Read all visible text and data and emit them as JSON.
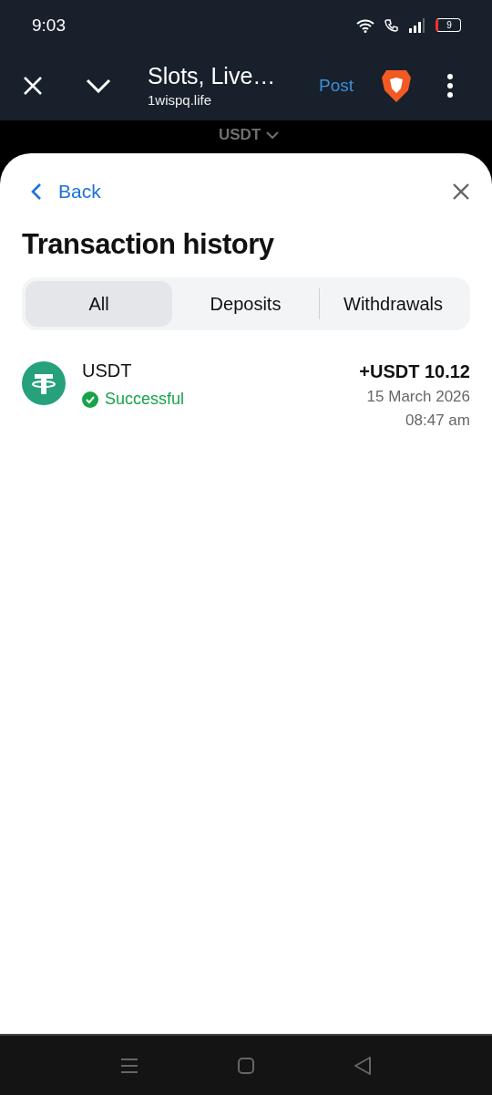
{
  "status_bar": {
    "time": "9:03",
    "battery": "9"
  },
  "browser_bar": {
    "title": "Slots, Live…",
    "url": "1wispq.life",
    "action": "Post"
  },
  "page_behind": {
    "currency": "USDT"
  },
  "sheet": {
    "back": "Back",
    "title": "Transaction history",
    "tabs": [
      {
        "label": "All",
        "selected": true
      },
      {
        "label": "Deposits",
        "selected": false
      },
      {
        "label": "Withdrawals",
        "selected": false
      }
    ],
    "transactions": [
      {
        "currency": "USDT",
        "status": "Successful",
        "amount": "+USDT 10.12",
        "date": "15 March 2026",
        "time": "08:47 am"
      }
    ]
  }
}
